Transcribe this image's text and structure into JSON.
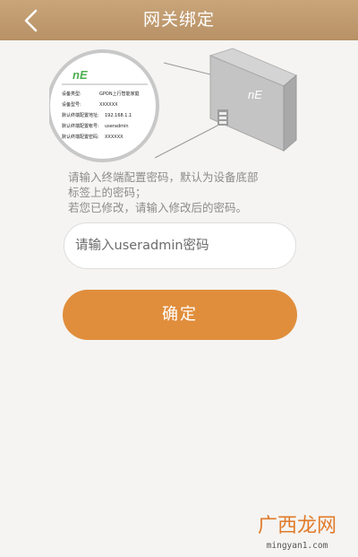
{
  "header": {
    "title": "网关绑定",
    "back_icon": "chevron-left-icon"
  },
  "illustration": {
    "logo": "nE",
    "label_rows": [
      {
        "key": "设备类型:",
        "value": "GPON上行智能家庭"
      },
      {
        "key": "设备型号:",
        "value": "XXXXXX"
      },
      {
        "key": "默认终端配置地址:",
        "value": "192.168.1.1"
      },
      {
        "key": "默认终端配置帐号:",
        "value": "useradmin"
      },
      {
        "key": "默认终端配置密码:",
        "value": "XXXXXX"
      }
    ]
  },
  "hint": {
    "line1": "请输入终端配置密码，默认为设备底部",
    "line2": "标签上的密码；",
    "line3": "若您已修改，请输入修改后的密码。"
  },
  "password_field": {
    "placeholder": "请输入useradmin密码",
    "value": ""
  },
  "confirm_button": {
    "label": "确定"
  },
  "watermark": {
    "text": "广西龙网",
    "url": "mingyan1.com"
  },
  "colors": {
    "header": "#bf9a6f",
    "button": "#e08e3c",
    "background": "#f5f4f2",
    "watermark": "#e07a2a"
  }
}
